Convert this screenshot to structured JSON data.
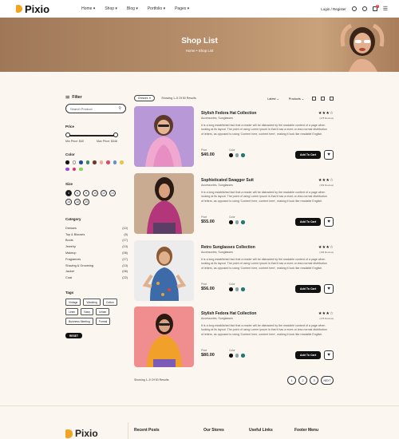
{
  "header": {
    "logo": "Pixio",
    "nav": [
      "Home",
      "Shop",
      "Blog",
      "Portfolio",
      "Pages"
    ],
    "login": "Login / Register",
    "cart_count": "0"
  },
  "hero": {
    "title": "Shop List",
    "breadcrumb": "Home  •  Shop List"
  },
  "sidebar": {
    "filter_title": "Filter",
    "search_placeholder": "Search Product",
    "price_label": "Price",
    "min_price": "Min Price: $40",
    "max_price": "Max Price: $346",
    "color_label": "Color",
    "colors": [
      "#111111",
      "#ffffff",
      "#1e4f9a",
      "#3c8a6a",
      "#6d3b2a",
      "#f2a9a0",
      "#d84d6c",
      "#6a8fd1",
      "#e7c648",
      "#9b4bd1",
      "#e1336a",
      "#7cd957"
    ],
    "size_label": "Size",
    "sizes": [
      "4",
      "6",
      "8",
      "10",
      "12",
      "14",
      "16",
      "18",
      "20"
    ],
    "category_label": "Category",
    "categories": [
      {
        "name": "Dresses",
        "count": "(10)"
      },
      {
        "name": "Top & Blouses",
        "count": "(5)"
      },
      {
        "name": "Boots",
        "count": "(17)"
      },
      {
        "name": "Jewelry",
        "count": "(13)"
      },
      {
        "name": "Makeup",
        "count": "(06)"
      },
      {
        "name": "Fragrances",
        "count": "(17)"
      },
      {
        "name": "Shaving & Grooming",
        "count": "(13)"
      },
      {
        "name": "Jacket",
        "count": "(06)"
      },
      {
        "name": "Coat",
        "count": "(22)"
      }
    ],
    "tags_label": "Tags",
    "tags": [
      "Vintage",
      "Wedding",
      "Cotton",
      "Linen",
      "Navy",
      "Urban",
      "Business Meeting",
      "Formal"
    ],
    "reset": "RESET"
  },
  "toolbar": {
    "chip": "Dresses",
    "showing": "Showing 1–5 Of 50 Results",
    "sort": "Latest",
    "products": "Products"
  },
  "products": [
    {
      "name": "Stylish Fedora Hat Collection",
      "category": "Accessories, Sunglasses",
      "reviews": "(178 Review)",
      "description": "It is a long established fact that a reader will be distracted by the readable content of a page when looking at its layout. The point of using Lorem Ipsum is that it has a more-or-less normal distribution of letters, as opposed to using 'Content here, content here', making it look like readable English.",
      "price_label": "Price",
      "price": "$40.00",
      "color_label": "Color",
      "add_to_cart": "Add To Cart"
    },
    {
      "name": "Sophisticated Swagger Suit",
      "category": "Accessories, Sunglasses",
      "reviews": "(159 Review)",
      "description": "It is a long established fact that a reader will be distracted by the readable content of a page when looking at its layout. The point of using Lorem Ipsum is that it has a more-or-less normal distribution of letters, as opposed to using 'Content here, content here', making it look like readable English.",
      "price_label": "Price",
      "price": "$55.00",
      "color_label": "Color",
      "add_to_cart": "Add To Cart"
    },
    {
      "name": "Retro Sunglasses Collection",
      "category": "Accessories, Sunglasses",
      "reviews": "(165 Review)",
      "description": "It is a long established fact that a reader will be distracted by the readable content of a page when looking at its layout. The point of using Lorem Ipsum is that it has a more-or-less normal distribution of letters, as opposed to using 'Content here, content here', making it look like readable English.",
      "price_label": "Price",
      "price": "$56.00",
      "color_label": "Color",
      "add_to_cart": "Add To Cart"
    },
    {
      "name": "Stylish Fedora Hat Collection",
      "category": "Accessories, Sunglasses",
      "reviews": "(178 Review)",
      "description": "It is a long established fact that a reader will be distracted by the readable content of a page when looking at its layout. The point of using Lorem Ipsum is that it has a more-or-less normal distribution of letters, as opposed to using 'Content here, content here', making it look like readable English.",
      "price_label": "Price",
      "price": "$80.00",
      "color_label": "Color",
      "add_to_cart": "Add To Cart"
    }
  ],
  "pagination": {
    "showing": "Showing 1–5 Of 50 Results",
    "pages": [
      "1",
      "2",
      "3"
    ],
    "next": "NEXT"
  },
  "footer": {
    "logo": "Pixio",
    "columns": [
      "Recent Posts",
      "Our Stores",
      "Useful Links",
      "Footer Menu"
    ]
  },
  "colors": {
    "accent": "#f1a41f",
    "background": "#fbf6ef",
    "dark": "#111111"
  }
}
